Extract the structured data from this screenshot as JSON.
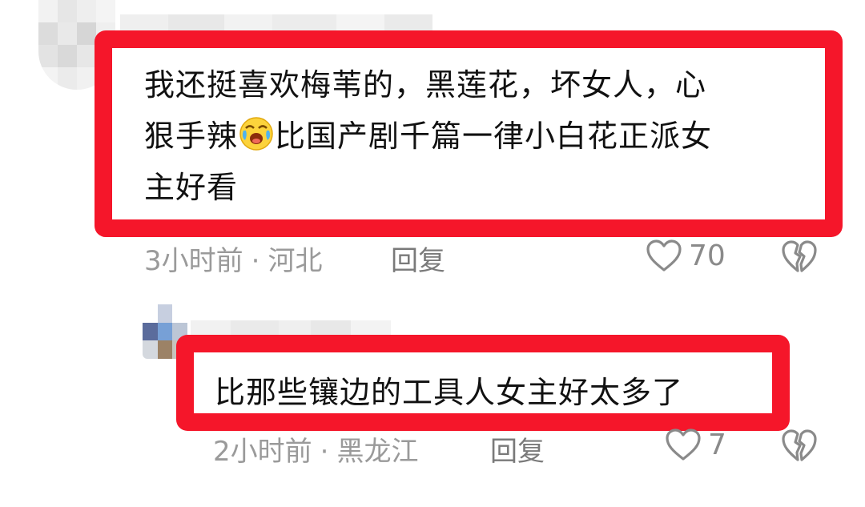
{
  "comments": [
    {
      "text_line1": "我还挺喜欢梅苇的，黑莲花，坏女人，心",
      "text_line2_before": "狠手辣",
      "text_line2_emoji": "crying-laughing-emoji",
      "text_line2_after": "比国产剧千篇一律小白花正派女",
      "text_line3": "主好看",
      "time": "3小时前",
      "separator": "·",
      "location": "河北",
      "reply_label": "回复",
      "likes": "70",
      "highlight_color": "#f5162a"
    },
    {
      "text": "比那些镶边的工具人女主好太多了",
      "time": "2小时前",
      "separator": "·",
      "location": "黑龙江",
      "reply_label": "回复",
      "likes": "7",
      "highlight_color": "#f5162a"
    }
  ],
  "icons": {
    "like": "heart-outline-icon",
    "dislike": "broken-heart-icon"
  }
}
